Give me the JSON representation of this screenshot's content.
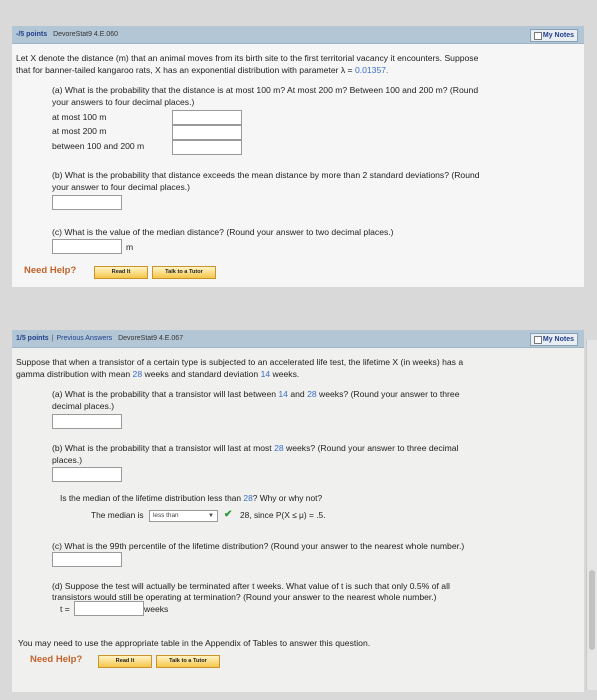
{
  "problem1": {
    "header": {
      "points": "-/5 points",
      "ref": "DevoreStat9 4.E.060",
      "notes": "My Notes"
    },
    "intro1": "Let X denote the distance (m) that an animal moves from its birth site to the first territorial vacancy it encounters. Suppose",
    "intro2_pre": "that for banner-tailed kangaroo rats, X has an exponential distribution with parameter λ = ",
    "lambda": "0.01357.",
    "a1": "(a) What is the probability that the distance is at most 100 m? At most 200 m? Between 100 and 200 m? (Round",
    "a2": "your answers to four decimal places.)",
    "rows": [
      "at most 100 m",
      "at most 200 m",
      "between 100 and 200 m"
    ],
    "b1": "(b) What is the probability that distance exceeds the mean distance by more than 2 standard deviations? (Round",
    "b2": "your answer to four decimal places.)",
    "c1": "(c) What is the value of the median distance? (Round your answer to two decimal places.)",
    "unit_m": "m",
    "help": "Need Help?",
    "read": "Read It",
    "tutor": "Talk to a Tutor"
  },
  "problem2": {
    "header": {
      "points": "1/5 points",
      "previous": "Previous Answers",
      "ref": "DevoreStat9 4.E.067",
      "notes": "My Notes"
    },
    "intro1": "Suppose that when a transistor of a certain type is subjected to an accelerated life test, the lifetime X (in weeks) has a",
    "intro2_pre": "gamma distribution with mean ",
    "mean": "28",
    "intro2_mid": " weeks and standard deviation ",
    "sd": "14",
    "intro2_post": " weeks.",
    "a1_pre": "(a) What is the probability that a transistor will last between ",
    "a1_v1": "14",
    "a1_mid": " and ",
    "a1_v2": "28",
    "a1_post": " weeks? (Round your answer to three",
    "a2": "decimal places.)",
    "b1_pre": "(b) What is the probability that a transistor will last at most ",
    "b1_v": "28",
    "b1_post": " weeks? (Round your answer to three decimal",
    "b2": "places.)",
    "median_q_pre": "Is the median of the lifetime distribution less than ",
    "median_q_v": "28",
    "median_q_post": "? Why or why not?",
    "median_label": "The median is",
    "median_select": "less than",
    "median_after": "28, since P(X ≤ μ) = .5.",
    "c1": "(c) What is the 99th percentile of the lifetime distribution? (Round your answer to the nearest whole number.)",
    "d1": "(d) Suppose the test will actually be terminated after t weeks. What value of t is such that only 0.5% of all",
    "d2": "transistors would still be operating at termination? (Round your answer to the nearest whole number.)",
    "t_label": "t =",
    "weeks": "weeks",
    "note": "You may need to use the appropriate table in the Appendix of Tables to answer this question.",
    "help": "Need Help?",
    "read": "Read It",
    "tutor": "Talk to a Tutor"
  },
  "colors": {
    "header_bg": "#b3c6d6",
    "highlight_value": "#3b6ec4",
    "help_text": "#c4632a",
    "button_gold": "#f5c64a",
    "check_green": "#2e9b3a"
  }
}
